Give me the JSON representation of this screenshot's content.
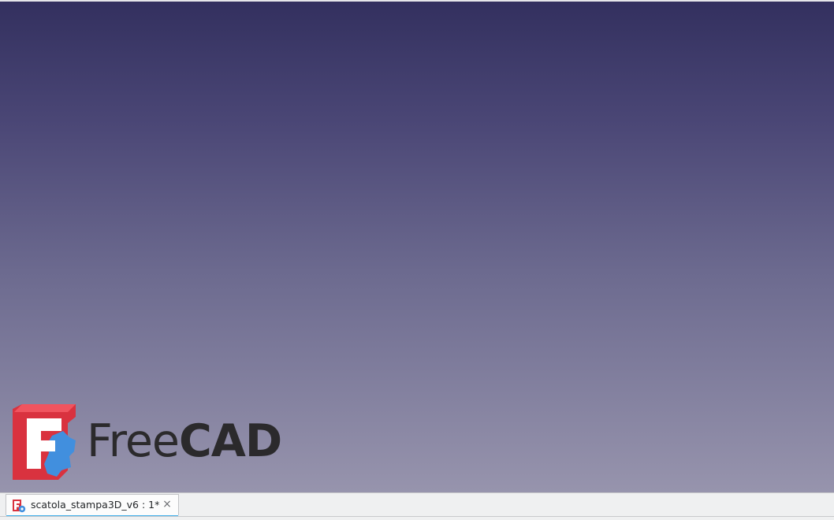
{
  "viewport": {
    "name": "3D view",
    "gradient_top": "#33305f",
    "gradient_bottom": "#9794ad"
  },
  "logo": {
    "brand_light": "Free",
    "brand_bold": "CAD",
    "icon": "freecad-logo-icon",
    "colors": {
      "red": "#d9323f",
      "red_light": "#f0545f",
      "blue": "#418fde",
      "white": "#ffffff",
      "text": "#2b2a2c"
    }
  },
  "tabs": [
    {
      "label": "scatola_stampa3D_v6 : 1*",
      "icon": "freecad-document-icon",
      "close_glyph": "×",
      "active": true
    }
  ],
  "accent_color": "#3daee9"
}
